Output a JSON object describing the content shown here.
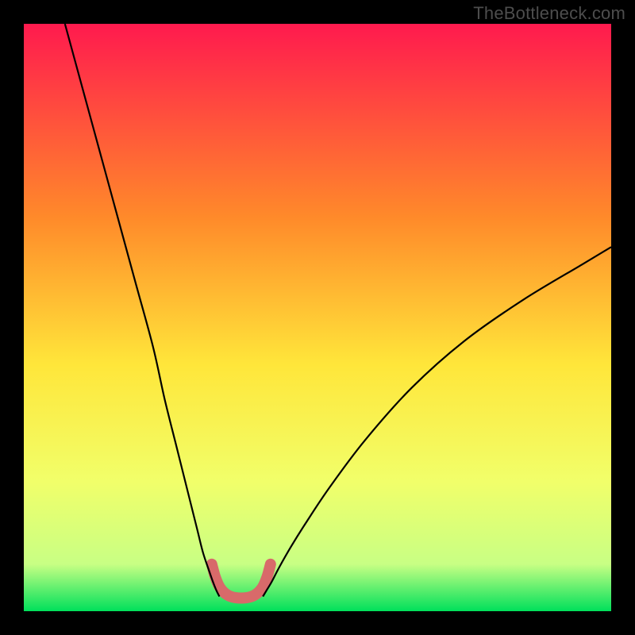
{
  "watermark": "TheBottleneck.com",
  "chart_data": {
    "type": "line",
    "title": "",
    "xlabel": "",
    "ylabel": "",
    "xlim": [
      0,
      100
    ],
    "ylim": [
      0,
      100
    ],
    "grid": false,
    "legend": false,
    "background_gradient": {
      "top": "#ff1a4e",
      "mid_upper": "#ff8a2a",
      "mid": "#ffe63a",
      "mid_lower": "#f1ff6a",
      "near_bottom": "#c8ff84",
      "bottom": "#00e05b"
    },
    "series": [
      {
        "name": "left-curve",
        "stroke": "#000000",
        "x": [
          7,
          10,
          13,
          16,
          19,
          22,
          24,
          26,
          28,
          29.5,
          30.5,
          31.5,
          32.2,
          32.8,
          33.3
        ],
        "y": [
          100,
          89,
          78,
          67,
          56,
          45,
          36,
          28,
          20,
          14,
          10,
          7,
          5,
          3.5,
          2.5
        ]
      },
      {
        "name": "right-curve",
        "stroke": "#000000",
        "x": [
          40.7,
          41.3,
          42.2,
          43.5,
          45.5,
          48,
          52,
          58,
          66,
          75,
          85,
          95,
          100
        ],
        "y": [
          2.5,
          3.5,
          5,
          7.5,
          11,
          15,
          21,
          29,
          38,
          46,
          53,
          59,
          62
        ]
      },
      {
        "name": "valley-marker",
        "stroke": "#d86a6a",
        "stroke_width": 14,
        "linecap": "round",
        "x": [
          32.0,
          32.6,
          33.4,
          34.6,
          36.0,
          38.0,
          39.4,
          40.6,
          41.4,
          42.0
        ],
        "y": [
          8.0,
          5.8,
          4.0,
          2.8,
          2.3,
          2.3,
          2.8,
          4.0,
          5.8,
          8.0
        ]
      }
    ],
    "annotations": []
  }
}
